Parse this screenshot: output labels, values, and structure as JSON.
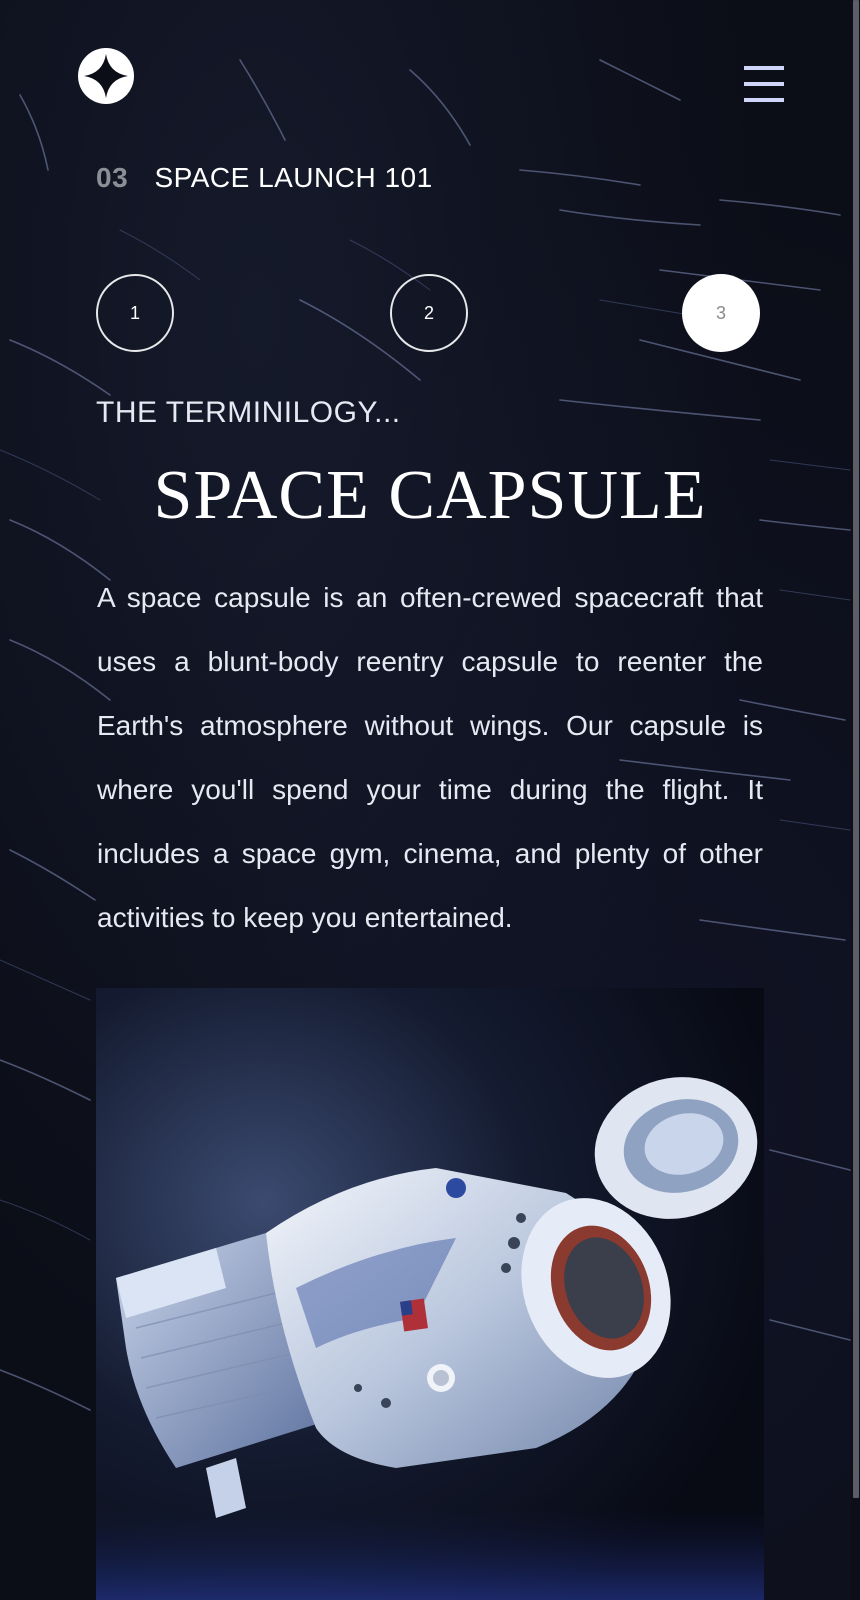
{
  "header": {
    "logo_icon": "star-logo-icon",
    "menu_icon": "hamburger-menu-icon"
  },
  "section": {
    "number": "03",
    "title": "SPACE LAUNCH 101"
  },
  "steps": [
    {
      "label": "1",
      "active": false
    },
    {
      "label": "2",
      "active": false
    },
    {
      "label": "3",
      "active": true
    }
  ],
  "content": {
    "subheading": "THE TERMINILOGY...",
    "title": "SPACE CAPSULE",
    "description": "A space capsule is an often-crewed spacecraft that uses a blunt-body reentry capsule to reenter the Earth's atmosphere without wings. Our capsule is where you'll spend your time during the flight. It includes a space gym, cinema, and plenty of other activities to keep you entertained."
  },
  "image": {
    "subject": "space-capsule-illustration"
  },
  "colors": {
    "background": "#0b0d17",
    "accent": "#d0d6f9",
    "text": "#ffffff",
    "muted": "#8d8f97"
  }
}
